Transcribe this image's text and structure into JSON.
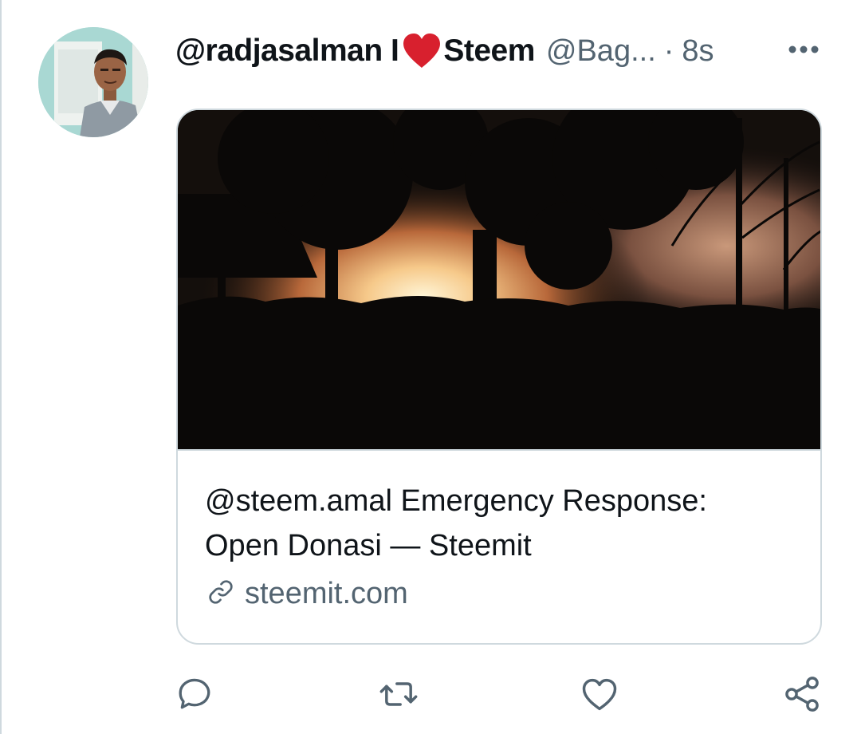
{
  "tweet": {
    "name_part1": "@radjasalman I",
    "name_part2": "Steem",
    "handle": "@Bag...",
    "separator": "·",
    "time": "8s"
  },
  "card": {
    "title_line1": "@steem.amal Emergency Response:",
    "title_line2": "Open Donasi — Steemit",
    "domain": "steemit.com"
  },
  "icons": {
    "heart": "heart-emoji-icon",
    "more": "more-options-icon",
    "link": "link-icon",
    "reply": "reply-icon",
    "retweet": "retweet-icon",
    "like": "like-icon",
    "share": "share-icon"
  },
  "colors": {
    "text_primary": "#0f1419",
    "text_secondary": "#536471",
    "border": "#cfd9de",
    "heart_red": "#d8202e"
  }
}
